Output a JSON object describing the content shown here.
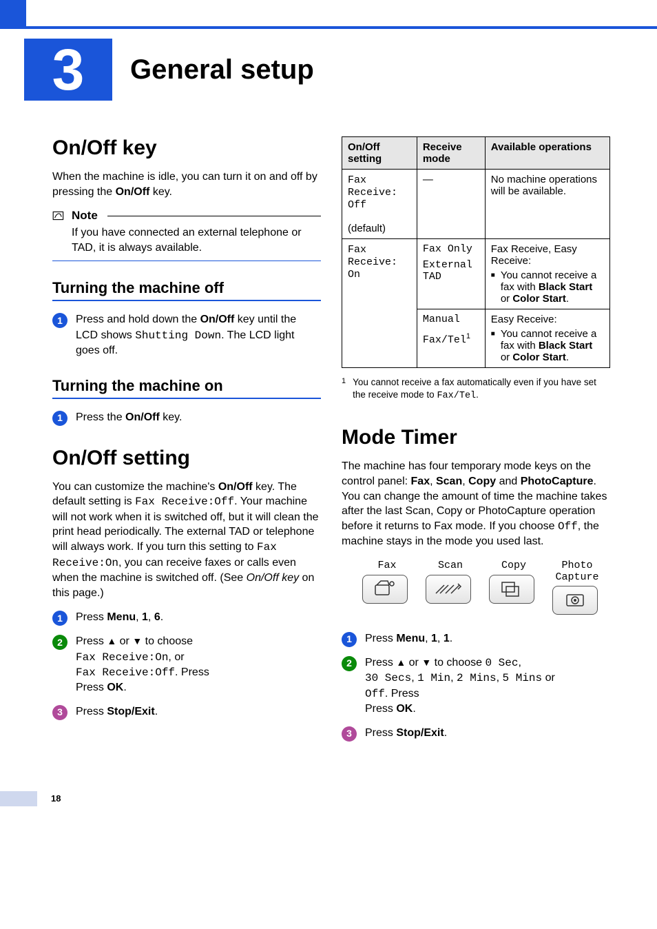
{
  "chapter": {
    "number": "3",
    "title": "General setup"
  },
  "pageNumber": "18",
  "left": {
    "h2_onoff_key": "On/Off key",
    "p1_a": "When the machine is idle, you can turn it on and off by pressing the ",
    "p1_b": "On/Off",
    "p1_c": " key.",
    "note_label": "Note",
    "note_body": "If you have connected an external telephone or TAD, it is always available.",
    "h3_off": "Turning the machine off",
    "off_step1_a": "Press and hold down the ",
    "off_step1_b": "On/Off",
    "off_step1_c": " key until the LCD shows ",
    "off_step1_d": "Shutting Down",
    "off_step1_e": ". The LCD light goes off.",
    "h3_on": "Turning the machine on",
    "on_step1_a": "Press the ",
    "on_step1_b": "On/Off",
    "on_step1_c": " key.",
    "h2_onoff_setting": "On/Off setting",
    "setting_p_a": "You can customize the machine's ",
    "setting_p_b": "On/Off",
    "setting_p_c": " key. The default setting is ",
    "setting_p_d": "Fax Receive:Off",
    "setting_p_e": ". Your machine will not work when it is switched off, but it will clean the print head periodically. The external TAD or telephone will always work. If you turn this setting to ",
    "setting_p_f": "Fax Receive:On",
    "setting_p_g": ", you can receive faxes or calls even when the machine is switched off. (See ",
    "setting_p_h": "On/Off key",
    "setting_p_i": " on this page.)",
    "s_step1_a": "Press ",
    "s_step1_b": "Menu",
    "s_step1_c": ", ",
    "s_step1_d": "1",
    "s_step1_e": ", ",
    "s_step1_f": "6",
    "s_step1_g": ".",
    "s_step2_a": "Press ",
    "s_step2_up": "▲",
    "s_step2_b": " or ",
    "s_step2_dn": "▼",
    "s_step2_c": " to choose ",
    "s_step2_d": "Fax Receive:On",
    "s_step2_e": ", or ",
    "s_step2_f": "Fax Receive:Off",
    "s_step2_g": ". Press ",
    "s_step2_h": "OK",
    "s_step2_i": ".",
    "s_step3_a": "Press ",
    "s_step3_b": "Stop/Exit",
    "s_step3_c": "."
  },
  "table": {
    "h1": "On/Off setting",
    "h2": "Receive mode",
    "h3": "Available operations",
    "r1c1a": "Fax Receive: Off",
    "r1c1b": "(default)",
    "r1c2": "—",
    "r1c3": "No machine operations will be available.",
    "r2c1": "Fax Receive: On",
    "r2c2a": "Fax Only",
    "r2c2b": "External TAD",
    "r2c3a": "Fax Receive, Easy Receive:",
    "r2c3b": "You cannot receive a fax with ",
    "r2c3c": "Black Start",
    "r2c3d": " or ",
    "r2c3e": "Color Start",
    "r2c3f": ".",
    "r3c2a": "Manual",
    "r3c2b": "Fax/Tel",
    "r3c2sup": "1",
    "r3c3a": "Easy Receive:",
    "r3c3b": "You cannot receive a fax with ",
    "r3c3c": "Black Start",
    "r3c3d": " or ",
    "r3c3e": "Color Start",
    "r3c3f": "."
  },
  "footnote": {
    "num": "1",
    "text_a": "You cannot receive a fax automatically even if you have set the receive mode to ",
    "text_b": "Fax/Tel",
    "text_c": "."
  },
  "right": {
    "h2_mode": "Mode Timer",
    "p_a": "The machine has four temporary mode keys on the control panel: ",
    "p_b": "Fax",
    "p_c": ", ",
    "p_d": "Scan",
    "p_e": ", ",
    "p_f": "Copy",
    "p_g": " and ",
    "p_h": "PhotoCapture",
    "p_i": ". You can change the amount of time the machine takes after the last Scan, Copy or PhotoCapture operation before it returns to Fax mode. If you choose ",
    "p_j": "Off",
    "p_k": ", the machine stays in the mode you used last.",
    "modes": {
      "fax": "Fax",
      "scan": "Scan",
      "copy": "Copy",
      "photo": "Photo\nCapture"
    },
    "m_step1_a": "Press ",
    "m_step1_b": "Menu",
    "m_step1_c": ", ",
    "m_step1_d": "1",
    "m_step1_e": ", ",
    "m_step1_f": "1",
    "m_step1_g": ".",
    "m_step2_a": "Press ",
    "m_step2_up": "▲",
    "m_step2_b": " or ",
    "m_step2_dn": "▼",
    "m_step2_c": " to choose ",
    "m_step2_d": "0 Sec",
    "m_step2_e": ", ",
    "m_step2_f": "30 Secs",
    "m_step2_g": ", ",
    "m_step2_h": "1 Min",
    "m_step2_i": ", ",
    "m_step2_j": "2 Mins",
    "m_step2_k": ", ",
    "m_step2_l": "5 Mins",
    "m_step2_m": " or ",
    "m_step2_n": "Off",
    "m_step2_o": ". Press ",
    "m_step2_p": "OK",
    "m_step2_q": ".",
    "m_step3_a": "Press ",
    "m_step3_b": "Stop/Exit",
    "m_step3_c": "."
  }
}
